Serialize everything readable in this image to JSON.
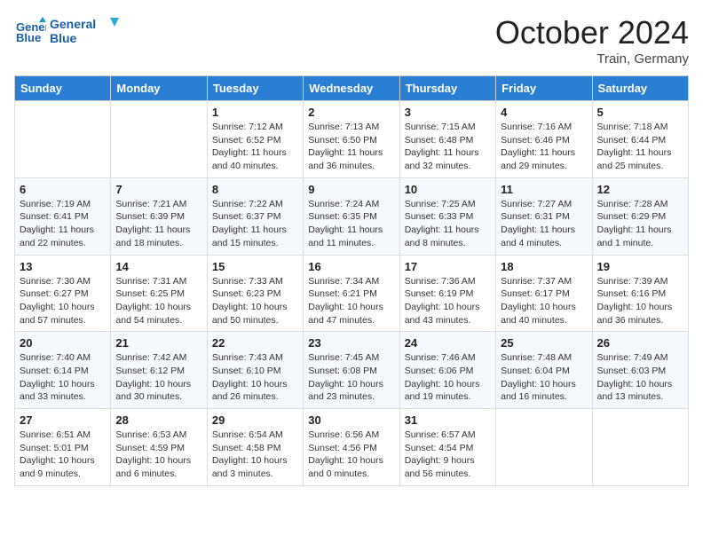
{
  "header": {
    "logo_line1": "General",
    "logo_line2": "Blue",
    "month_year": "October 2024",
    "location": "Train, Germany"
  },
  "days_of_week": [
    "Sunday",
    "Monday",
    "Tuesday",
    "Wednesday",
    "Thursday",
    "Friday",
    "Saturday"
  ],
  "weeks": [
    [
      {
        "day": "",
        "sunrise": "",
        "sunset": "",
        "daylight": ""
      },
      {
        "day": "",
        "sunrise": "",
        "sunset": "",
        "daylight": ""
      },
      {
        "day": "1",
        "sunrise": "Sunrise: 7:12 AM",
        "sunset": "Sunset: 6:52 PM",
        "daylight": "Daylight: 11 hours and 40 minutes."
      },
      {
        "day": "2",
        "sunrise": "Sunrise: 7:13 AM",
        "sunset": "Sunset: 6:50 PM",
        "daylight": "Daylight: 11 hours and 36 minutes."
      },
      {
        "day": "3",
        "sunrise": "Sunrise: 7:15 AM",
        "sunset": "Sunset: 6:48 PM",
        "daylight": "Daylight: 11 hours and 32 minutes."
      },
      {
        "day": "4",
        "sunrise": "Sunrise: 7:16 AM",
        "sunset": "Sunset: 6:46 PM",
        "daylight": "Daylight: 11 hours and 29 minutes."
      },
      {
        "day": "5",
        "sunrise": "Sunrise: 7:18 AM",
        "sunset": "Sunset: 6:44 PM",
        "daylight": "Daylight: 11 hours and 25 minutes."
      }
    ],
    [
      {
        "day": "6",
        "sunrise": "Sunrise: 7:19 AM",
        "sunset": "Sunset: 6:41 PM",
        "daylight": "Daylight: 11 hours and 22 minutes."
      },
      {
        "day": "7",
        "sunrise": "Sunrise: 7:21 AM",
        "sunset": "Sunset: 6:39 PM",
        "daylight": "Daylight: 11 hours and 18 minutes."
      },
      {
        "day": "8",
        "sunrise": "Sunrise: 7:22 AM",
        "sunset": "Sunset: 6:37 PM",
        "daylight": "Daylight: 11 hours and 15 minutes."
      },
      {
        "day": "9",
        "sunrise": "Sunrise: 7:24 AM",
        "sunset": "Sunset: 6:35 PM",
        "daylight": "Daylight: 11 hours and 11 minutes."
      },
      {
        "day": "10",
        "sunrise": "Sunrise: 7:25 AM",
        "sunset": "Sunset: 6:33 PM",
        "daylight": "Daylight: 11 hours and 8 minutes."
      },
      {
        "day": "11",
        "sunrise": "Sunrise: 7:27 AM",
        "sunset": "Sunset: 6:31 PM",
        "daylight": "Daylight: 11 hours and 4 minutes."
      },
      {
        "day": "12",
        "sunrise": "Sunrise: 7:28 AM",
        "sunset": "Sunset: 6:29 PM",
        "daylight": "Daylight: 11 hours and 1 minute."
      }
    ],
    [
      {
        "day": "13",
        "sunrise": "Sunrise: 7:30 AM",
        "sunset": "Sunset: 6:27 PM",
        "daylight": "Daylight: 10 hours and 57 minutes."
      },
      {
        "day": "14",
        "sunrise": "Sunrise: 7:31 AM",
        "sunset": "Sunset: 6:25 PM",
        "daylight": "Daylight: 10 hours and 54 minutes."
      },
      {
        "day": "15",
        "sunrise": "Sunrise: 7:33 AM",
        "sunset": "Sunset: 6:23 PM",
        "daylight": "Daylight: 10 hours and 50 minutes."
      },
      {
        "day": "16",
        "sunrise": "Sunrise: 7:34 AM",
        "sunset": "Sunset: 6:21 PM",
        "daylight": "Daylight: 10 hours and 47 minutes."
      },
      {
        "day": "17",
        "sunrise": "Sunrise: 7:36 AM",
        "sunset": "Sunset: 6:19 PM",
        "daylight": "Daylight: 10 hours and 43 minutes."
      },
      {
        "day": "18",
        "sunrise": "Sunrise: 7:37 AM",
        "sunset": "Sunset: 6:17 PM",
        "daylight": "Daylight: 10 hours and 40 minutes."
      },
      {
        "day": "19",
        "sunrise": "Sunrise: 7:39 AM",
        "sunset": "Sunset: 6:16 PM",
        "daylight": "Daylight: 10 hours and 36 minutes."
      }
    ],
    [
      {
        "day": "20",
        "sunrise": "Sunrise: 7:40 AM",
        "sunset": "Sunset: 6:14 PM",
        "daylight": "Daylight: 10 hours and 33 minutes."
      },
      {
        "day": "21",
        "sunrise": "Sunrise: 7:42 AM",
        "sunset": "Sunset: 6:12 PM",
        "daylight": "Daylight: 10 hours and 30 minutes."
      },
      {
        "day": "22",
        "sunrise": "Sunrise: 7:43 AM",
        "sunset": "Sunset: 6:10 PM",
        "daylight": "Daylight: 10 hours and 26 minutes."
      },
      {
        "day": "23",
        "sunrise": "Sunrise: 7:45 AM",
        "sunset": "Sunset: 6:08 PM",
        "daylight": "Daylight: 10 hours and 23 minutes."
      },
      {
        "day": "24",
        "sunrise": "Sunrise: 7:46 AM",
        "sunset": "Sunset: 6:06 PM",
        "daylight": "Daylight: 10 hours and 19 minutes."
      },
      {
        "day": "25",
        "sunrise": "Sunrise: 7:48 AM",
        "sunset": "Sunset: 6:04 PM",
        "daylight": "Daylight: 10 hours and 16 minutes."
      },
      {
        "day": "26",
        "sunrise": "Sunrise: 7:49 AM",
        "sunset": "Sunset: 6:03 PM",
        "daylight": "Daylight: 10 hours and 13 minutes."
      }
    ],
    [
      {
        "day": "27",
        "sunrise": "Sunrise: 6:51 AM",
        "sunset": "Sunset: 5:01 PM",
        "daylight": "Daylight: 10 hours and 9 minutes."
      },
      {
        "day": "28",
        "sunrise": "Sunrise: 6:53 AM",
        "sunset": "Sunset: 4:59 PM",
        "daylight": "Daylight: 10 hours and 6 minutes."
      },
      {
        "day": "29",
        "sunrise": "Sunrise: 6:54 AM",
        "sunset": "Sunset: 4:58 PM",
        "daylight": "Daylight: 10 hours and 3 minutes."
      },
      {
        "day": "30",
        "sunrise": "Sunrise: 6:56 AM",
        "sunset": "Sunset: 4:56 PM",
        "daylight": "Daylight: 10 hours and 0 minutes."
      },
      {
        "day": "31",
        "sunrise": "Sunrise: 6:57 AM",
        "sunset": "Sunset: 4:54 PM",
        "daylight": "Daylight: 9 hours and 56 minutes."
      },
      {
        "day": "",
        "sunrise": "",
        "sunset": "",
        "daylight": ""
      },
      {
        "day": "",
        "sunrise": "",
        "sunset": "",
        "daylight": ""
      }
    ]
  ]
}
